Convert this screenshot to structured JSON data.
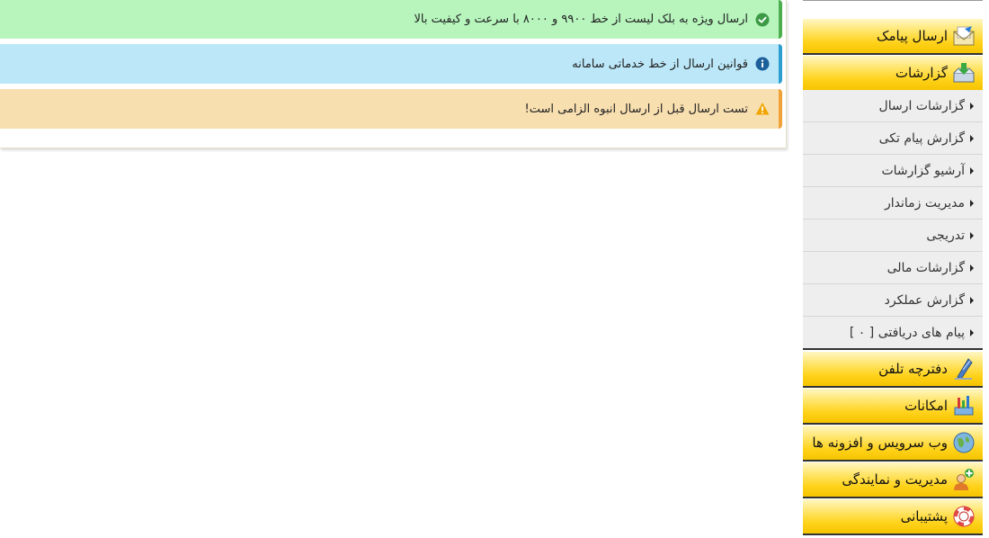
{
  "alerts": [
    {
      "type": "success",
      "icon": "check-circle-icon",
      "text": "ارسال ویژه به بلک لیست از خط ۹۹۰۰ و ۸۰۰۰ با سرعت و کیفیت بالا"
    },
    {
      "type": "info",
      "icon": "info-circle-icon",
      "text": "قوانین ارسال از خط خدماتی سامانه"
    },
    {
      "type": "warning",
      "icon": "warning-triangle-icon",
      "text": "تست ارسال قبل از ارسال انبوه الزامی است!"
    }
  ],
  "sidebar": {
    "sections": {
      "send_sms": {
        "label": "ارسال پیامک",
        "icon": "envelope-icon"
      },
      "reports": {
        "label": "گزارشات",
        "icon": "inbox-download-icon"
      },
      "phonebook": {
        "label": "دفترچه تلفن",
        "icon": "notebook-icon"
      },
      "features": {
        "label": "امکانات",
        "icon": "tools-icon"
      },
      "web_service": {
        "label": "وب سرویس و افزونه ها",
        "icon": "globe-icon"
      },
      "management": {
        "label": "مدیریت و نمایندگی",
        "icon": "user-add-icon"
      },
      "support": {
        "label": "پشتیبانی",
        "icon": "lifebuoy-icon"
      }
    },
    "report_items": [
      "گزارشات ارسال",
      "گزارش پیام تکی",
      "آرشیو گزارشات",
      "مدیریت زماندار",
      "تدریجی",
      "گزارشات مالی",
      "گزارش عملکرد",
      "پیام های دریافتی [ ۰ ]"
    ]
  },
  "colors": {
    "success_bg": "#b7f5bd",
    "info_bg": "#bbe7f8",
    "warning_bg": "#f8dfb0",
    "section_gold": "#ffd21a"
  }
}
